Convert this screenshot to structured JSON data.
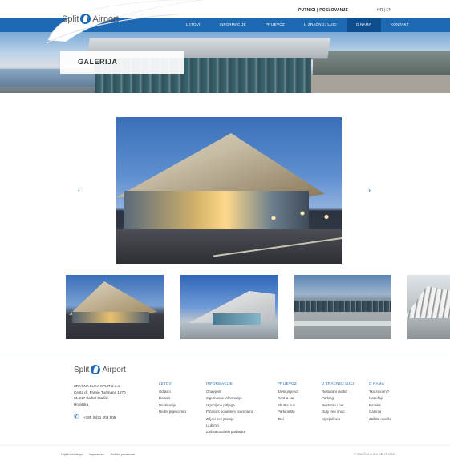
{
  "header": {
    "logo": {
      "text_left": "Split",
      "text_right": "Airport"
    },
    "top_links": [
      "PUTNICI",
      "POSLOVANJE"
    ],
    "languages": [
      "HR",
      "EN"
    ],
    "nav": [
      {
        "label": "LETOVI",
        "active": false
      },
      {
        "label": "INFORMACIJE",
        "active": false
      },
      {
        "label": "PRIJEVOZ",
        "active": false
      },
      {
        "label": "U ZRAČNOJ LUCI",
        "active": false
      },
      {
        "label": "O NAMA",
        "active": true
      },
      {
        "label": "KONTAKT",
        "active": false
      }
    ],
    "accent_color": "#1d6ab3"
  },
  "hero": {
    "title": "GALERIJA"
  },
  "gallery": {
    "prev_icon": "chevron-left-icon",
    "next_icon": "chevron-right-icon",
    "prev_glyph": "‹",
    "next_glyph": "›",
    "thumbnail_count": 4
  },
  "footer": {
    "logo": {
      "text_left": "Split",
      "text_right": "Airport"
    },
    "address": [
      "ZRAČNA LUKA SPLIT d.o.o.",
      "Cesta dr. Franje Tuđmana 1270",
      "21 217 Kaštel Štafilić",
      "Hrvatska"
    ],
    "phone": "+385 (0)21 203 506",
    "columns": [
      {
        "heading": "LETOVI",
        "items": [
          "Odlasci",
          "Dolasci",
          "Destinacije",
          "Redni prijevoznici"
        ]
      },
      {
        "heading": "INFORMACIJE",
        "items": [
          "Obavijesti",
          "Sigurnosne informacije",
          "Izgubljena prtljaga",
          "Putnici s posebnim potrebama",
          "Zdjeci bez pratnje",
          "Ljubimci",
          "Zaštita osobnih podataka"
        ]
      },
      {
        "heading": "PRIJEVOZ",
        "items": [
          "Javni prijevoz",
          "Rent-a-car",
          "Shuttle bus",
          "Parkiralište",
          "Taxi"
        ]
      },
      {
        "heading": "U ZRAČNOJ LUCI",
        "items": [
          "Restorani i kafići",
          "Parking",
          "Restoran i bar",
          "Duty free shop",
          "Mjenjačnica"
        ]
      },
      {
        "heading": "O NAMA",
        "items": [
          "Tko smo mi?",
          "Natječaji",
          "Kodeks",
          "Galerija",
          "Zaštita okoliša"
        ]
      }
    ],
    "bottom_links": [
      "Uvjeti korištenja",
      "Impressum",
      "Politika privatnosti"
    ],
    "copyright": "© ZRAČNA LUKA SPLIT 2020"
  }
}
